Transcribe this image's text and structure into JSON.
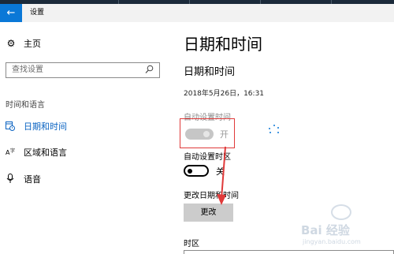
{
  "window": {
    "back_glyph": "←",
    "title": "设置"
  },
  "sidebar": {
    "home": {
      "icon": "gear-icon",
      "label": "主页"
    },
    "search": {
      "placeholder": "查找设置",
      "icon": "search-icon"
    },
    "section_heading": "时间和语言",
    "items": [
      {
        "icon": "calendar-clock-icon",
        "label": "日期和时间",
        "active": true
      },
      {
        "icon": "language-icon",
        "label": "区域和语言",
        "active": false
      },
      {
        "icon": "microphone-icon",
        "label": "语音",
        "active": false
      }
    ]
  },
  "main": {
    "page_title": "日期和时间",
    "section_title": "日期和时间",
    "current_datetime": "2018年5月26日，16:31",
    "auto_time": {
      "label": "自动设置时间",
      "state": "开",
      "on": true,
      "disabled": true
    },
    "auto_timezone": {
      "label": "自动设置时区",
      "state": "关",
      "on": false
    },
    "change_datetime": {
      "label": "更改日期和时间",
      "button": "更改"
    },
    "timezone_label": "时区"
  },
  "annotation": {
    "highlight_color": "#e03a3a",
    "arrow_color": "#e03a3a"
  },
  "watermark": {
    "text": "Bai 经验",
    "url": "jingyan.baidu.com"
  },
  "colors": {
    "accent": "#0a78d7",
    "active_nav": "#0a63c2",
    "button_bg": "#cccccc"
  }
}
